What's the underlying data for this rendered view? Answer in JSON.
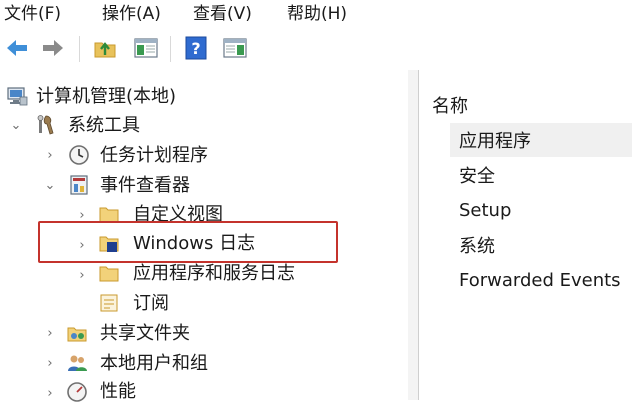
{
  "menu": [
    "文件(F)",
    "操作(A)",
    "查看(V)",
    "帮助(H)"
  ],
  "toolbar": {
    "buttons": [
      "back-arrow-icon",
      "forward-arrow-icon",
      "up-folder-icon",
      "show-hide-console-tree-icon",
      "help-icon",
      "show-hide-action-pane-icon"
    ]
  },
  "tree": {
    "root": "计算机管理(本地)",
    "system_tools": "系统工具",
    "task_scheduler": "任务计划程序",
    "event_viewer": "事件查看器",
    "custom_views": "自定义视图",
    "windows_logs": "Windows 日志",
    "app_service_logs": "应用程序和服务日志",
    "subscriptions": "订阅",
    "shared_folders": "共享文件夹",
    "local_users_groups": "本地用户和组",
    "performance": "性能"
  },
  "list": {
    "header": "名称",
    "items": [
      "应用程序",
      "安全",
      "Setup",
      "系统",
      "Forwarded Events"
    ],
    "selected_index": 0
  },
  "colors": {
    "highlight_border": "#c4332c",
    "selected_row": "#f0f0f0"
  }
}
